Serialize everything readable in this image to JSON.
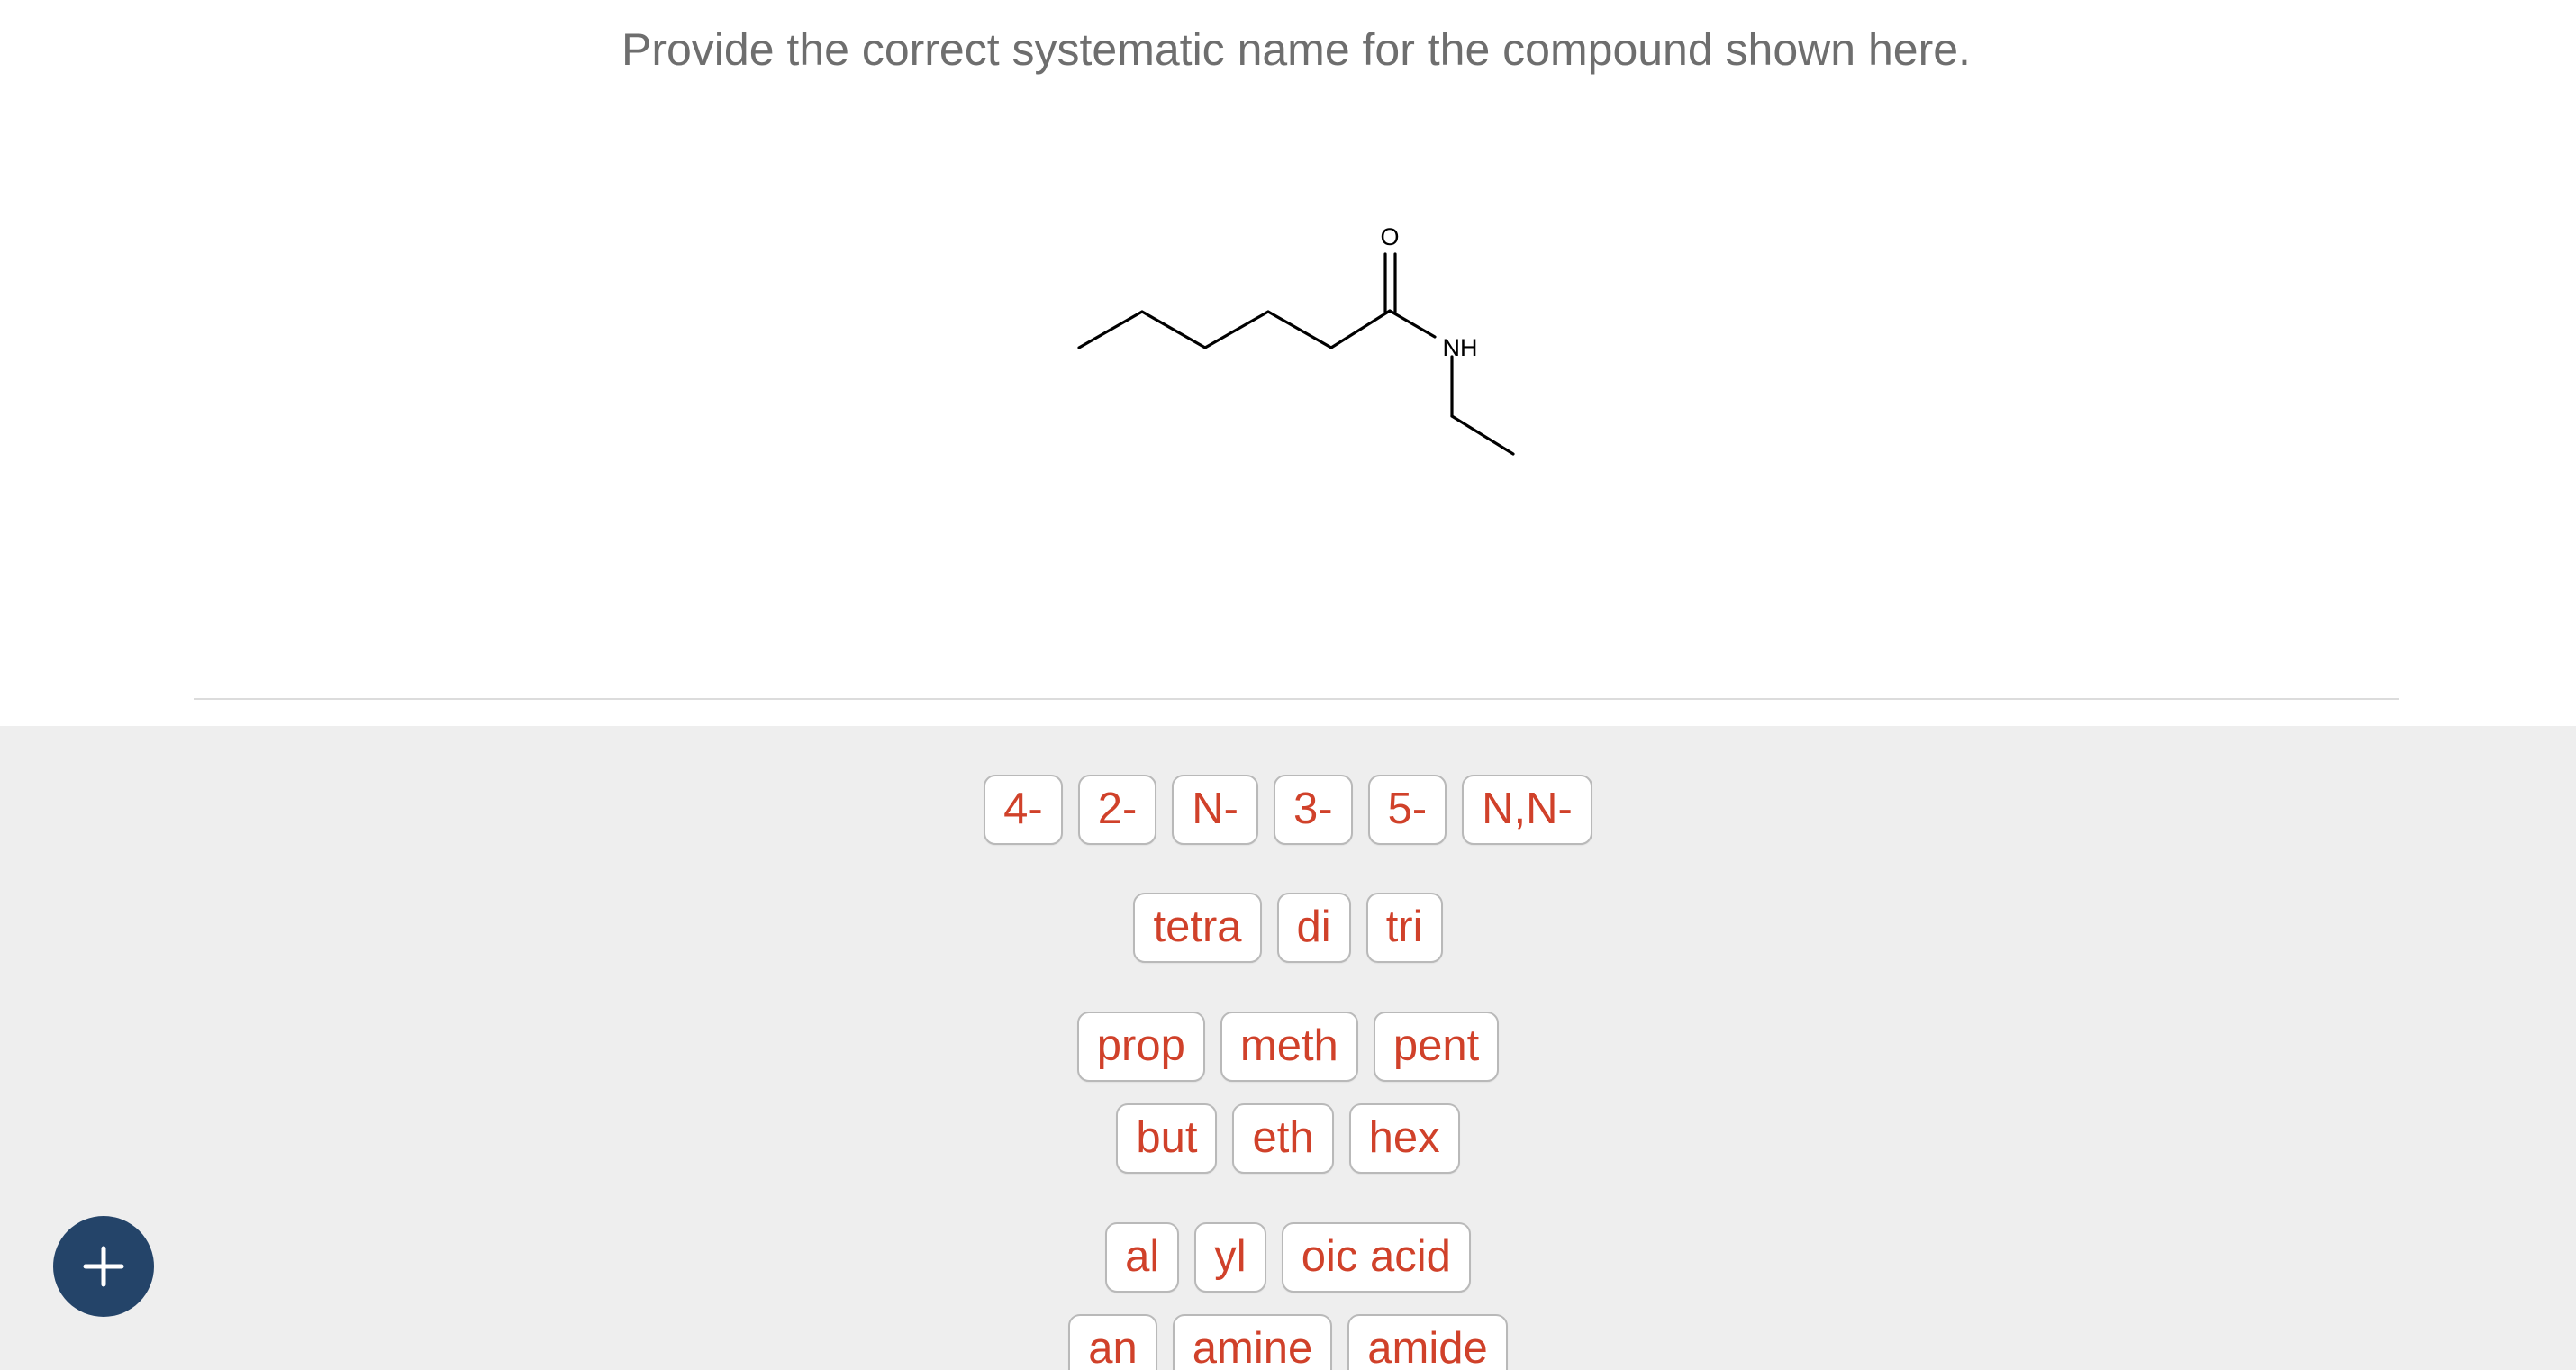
{
  "question": "Provide the correct systematic name for the compound shown here.",
  "structure": {
    "labels": {
      "oxygen": "O",
      "nitrogen": "NH"
    }
  },
  "tiles": {
    "locants": [
      "4-",
      "2-",
      "N-",
      "3-",
      "5-",
      "N,N-"
    ],
    "multipliers": [
      "tetra",
      "di",
      "tri"
    ],
    "roots_a": [
      "prop",
      "meth",
      "pent"
    ],
    "roots_b": [
      "but",
      "eth",
      "hex"
    ],
    "suffixes_a": [
      "al",
      "yl",
      "oic acid"
    ],
    "suffixes_b": [
      "an",
      "amine",
      "amide"
    ]
  },
  "add_button": {
    "icon": "plus-icon"
  },
  "colors": {
    "tile_text": "#d0412a",
    "fab_background": "#244469",
    "answer_area_background": "#eeeeee"
  }
}
